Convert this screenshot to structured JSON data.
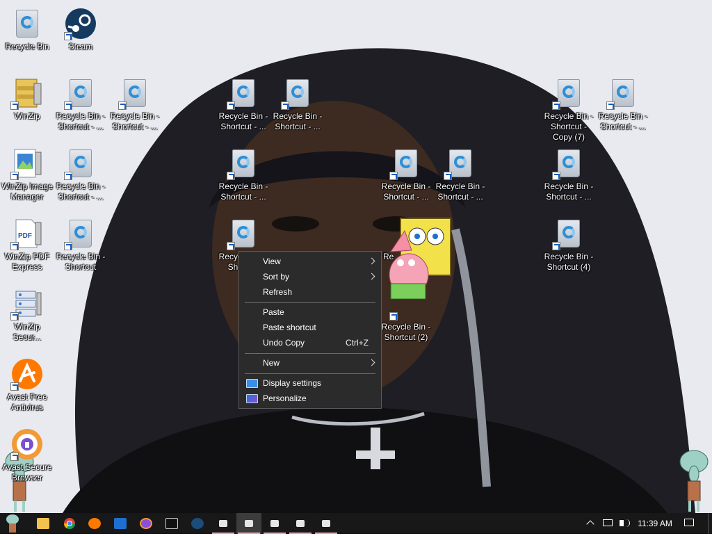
{
  "desktop": {
    "icons": [
      {
        "label": "Recycle Bin",
        "type": "bin"
      },
      {
        "label": "Steam",
        "type": "steam"
      },
      {
        "label": "WinZip",
        "type": "winzip"
      },
      {
        "label": "Recycle Bin - Shortcut - ...",
        "type": "bin"
      },
      {
        "label": "Recycle Bin - Shortcut - ...",
        "type": "bin"
      },
      {
        "label": "Recycle Bin - Shortcut - ...",
        "type": "bin"
      },
      {
        "label": "Recycle Bin - Shortcut - ...",
        "type": "bin"
      },
      {
        "label": "Recycle Bin - Shortcut - Copy (7)",
        "type": "bin"
      },
      {
        "label": "Recycle Bin - Shortcut - ...",
        "type": "bin"
      },
      {
        "label": "WinZip Image Manager",
        "type": "image"
      },
      {
        "label": "Recycle Bin - Shortcut - ...",
        "type": "bin"
      },
      {
        "label": "Recycle Bin - Shortcut - ...",
        "type": "bin"
      },
      {
        "label": "Recycle Bin - Shortcut - ...",
        "type": "bin"
      },
      {
        "label": "Recycle Bin - Shortcut - ...",
        "type": "bin"
      },
      {
        "label": "Recycle Bin - Shortcut - ...",
        "type": "bin"
      },
      {
        "label": "WinZip PDF Express",
        "type": "pdf"
      },
      {
        "label": "Recycle Bin - Shortcut",
        "type": "bin"
      },
      {
        "label": "Recycle Bin - Shortcut (4)",
        "type": "bin"
      },
      {
        "label": "WinZip Secur...",
        "type": "secure"
      },
      {
        "label": "Recycle Bin - Shortcut (2)",
        "type": "bin"
      },
      {
        "label": "Avast Free Antivirus",
        "type": "avast"
      },
      {
        "label": "Avast Secure Browser",
        "type": "avastbrowser"
      }
    ],
    "partial_labels": [
      "Recycle Bin - Shortcut",
      "Re"
    ]
  },
  "context_menu": {
    "items": [
      {
        "label": "View",
        "submenu": true
      },
      {
        "label": "Sort by",
        "submenu": true
      },
      {
        "label": "Refresh"
      },
      {
        "label": "Paste"
      },
      {
        "label": "Paste shortcut"
      },
      {
        "label": "Undo Copy",
        "shortcut": "Ctrl+Z"
      },
      {
        "label": "New",
        "submenu": true
      },
      {
        "label": "Display settings",
        "icon": "display-icon"
      },
      {
        "label": "Personalize",
        "icon": "personalize-icon"
      }
    ]
  },
  "taskbar": {
    "apps": [
      {
        "name": "start-button",
        "icon": "squidward-start-icon"
      },
      {
        "name": "file-explorer",
        "icon": "folder-icon",
        "color": "#f2c14e"
      },
      {
        "name": "chrome",
        "icon": "chrome-icon",
        "color": "#db4437"
      },
      {
        "name": "avast",
        "icon": "avast-icon",
        "color": "#ff7800"
      },
      {
        "name": "winzip",
        "icon": "winzip-icon",
        "color": "#1e6fcf"
      },
      {
        "name": "avast-secure-browser",
        "icon": "browser-icon",
        "color": "#8a4fd8"
      },
      {
        "name": "command-prompt",
        "icon": "cmd-icon",
        "color": "#cfcfcf"
      },
      {
        "name": "steam",
        "icon": "steam-icon",
        "color": "#1b4c7a"
      },
      {
        "name": "window-1",
        "icon": "window-icon",
        "color": "#e6e6e6"
      },
      {
        "name": "window-2",
        "icon": "window-icon",
        "color": "#e6e6e6",
        "active": true
      },
      {
        "name": "window-3",
        "icon": "window-icon",
        "color": "#e6e6e6"
      },
      {
        "name": "window-4",
        "icon": "window-icon",
        "color": "#e6e6e6"
      },
      {
        "name": "window-5",
        "icon": "window-icon",
        "color": "#e6e6e6"
      }
    ],
    "clock": "11:39 AM"
  }
}
